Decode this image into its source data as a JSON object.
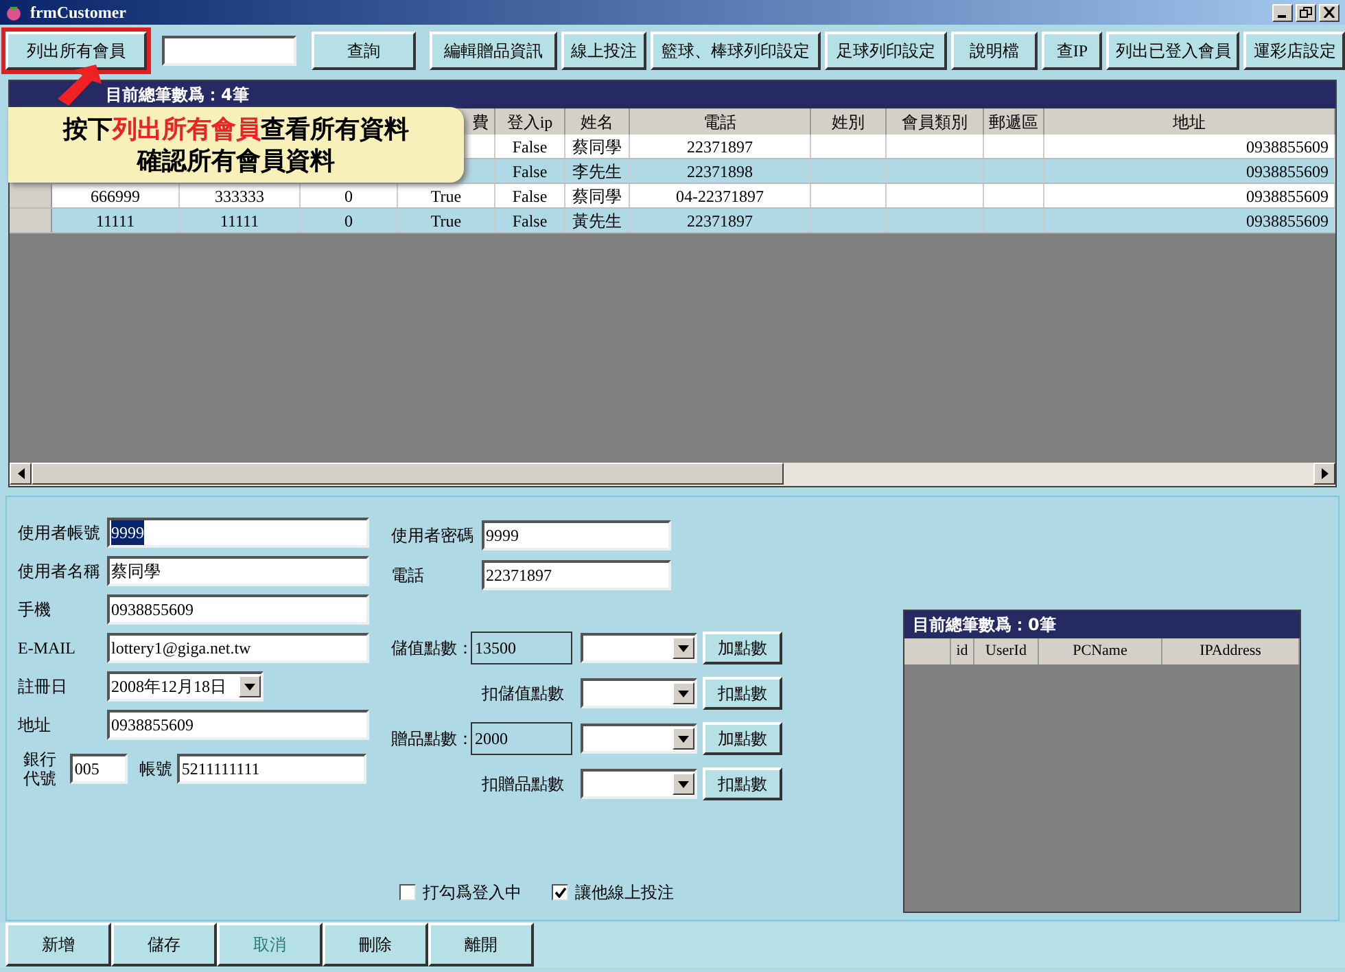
{
  "window": {
    "title": "frmCustomer"
  },
  "toolbar": [
    {
      "kind": "button",
      "label": "列出所有會員",
      "highlighted": true
    },
    {
      "kind": "field"
    },
    {
      "kind": "button",
      "label": "查詢",
      "highlighted": false
    },
    {
      "kind": "button",
      "label": "編輯贈品資訊",
      "highlighted": false
    },
    {
      "kind": "button",
      "label": "線上投注",
      "highlighted": false
    },
    {
      "kind": "button",
      "label": "籃球、棒球列印設定",
      "highlighted": false
    },
    {
      "kind": "button",
      "label": "足球列印設定",
      "highlighted": false
    },
    {
      "kind": "button",
      "label": "說明檔",
      "highlighted": false
    },
    {
      "kind": "button",
      "label": "查IP",
      "highlighted": false
    },
    {
      "kind": "button",
      "label": "列出已登入會員",
      "highlighted": false
    },
    {
      "kind": "button",
      "label": "運彩店設定",
      "highlighted": false
    }
  ],
  "callout": {
    "lines": [
      [
        {
          "text": "按下",
          "emphasis": false
        },
        {
          "text": "列出所有會員",
          "emphasis": true
        },
        {
          "text": "查看所有資料",
          "emphasis": false
        }
      ],
      [
        {
          "text": "確認所有會員資料",
          "emphasis": false
        }
      ]
    ]
  },
  "grid": {
    "title": "目前總筆數爲：4筆",
    "columns": [
      null,
      null,
      null,
      "費",
      "登入ip",
      "姓名",
      "電話",
      "姓別",
      "會員類別",
      "郵遞區",
      "地址"
    ],
    "rows": [
      {
        "cells": [
          null,
          null,
          null,
          null,
          "False",
          "蔡同學",
          "22371897",
          null,
          null,
          null,
          "0938855609"
        ]
      },
      {
        "cells": [
          null,
          null,
          null,
          null,
          "False",
          "李先生",
          "22371898",
          null,
          null,
          null,
          "0938855609"
        ]
      },
      {
        "cells": [
          "666999",
          "333333",
          "0",
          "True",
          "False",
          "蔡同學",
          "04-22371897",
          null,
          null,
          null,
          "0938855609"
        ]
      },
      {
        "cells": [
          "11111",
          "11111",
          "0",
          "True",
          "False",
          "黃先生",
          "22371897",
          null,
          null,
          null,
          "0938855609"
        ]
      }
    ]
  },
  "form": {
    "left": [
      {
        "kind": "text",
        "label": "使用者帳號",
        "value": "9999",
        "text_selected": true
      },
      {
        "kind": "text",
        "label": "使用者名稱",
        "value": "蔡同學",
        "text_selected": false
      },
      {
        "kind": "text",
        "label": "手機",
        "value": "0938855609",
        "text_selected": false
      },
      {
        "kind": "text",
        "label": "E-MAIL",
        "value": "lottery1@giga.net.tw",
        "text_selected": false
      },
      {
        "kind": "date",
        "label": "註冊日",
        "value": "2008年12月18日"
      },
      {
        "kind": "text",
        "label": "地址",
        "value": "0938855609",
        "text_selected": false
      },
      {
        "kind": "bank",
        "label": "銀行代號",
        "value": "005",
        "account_label": "帳號",
        "account_value": "5211111111"
      }
    ],
    "right": [
      {
        "kind": "text",
        "label": "使用者密碼",
        "value": "9999"
      },
      {
        "kind": "text",
        "label": "電話",
        "value": "22371897"
      },
      {
        "kind": "points",
        "label": "儲值點數：",
        "value": "13500",
        "button": "加點數"
      },
      {
        "kind": "deduct",
        "label": "扣儲值點數",
        "button": "扣點數"
      },
      {
        "kind": "points",
        "label": "贈品點數：",
        "value": "2000",
        "button": "加點數"
      },
      {
        "kind": "deduct",
        "label": "扣贈品點數",
        "button": "扣點數"
      }
    ],
    "checkboxes": [
      {
        "label": "打勾爲登入中",
        "checked": false
      },
      {
        "label": "讓他線上投注",
        "checked": true
      }
    ]
  },
  "logged_in": {
    "title": "目前總筆數爲：0筆",
    "columns": [
      "id",
      "UserId",
      "PCName",
      "IPAddress"
    ]
  },
  "bottom_buttons": [
    {
      "label": "新增",
      "disabled": false
    },
    {
      "label": "儲存",
      "disabled": false
    },
    {
      "label": "取消",
      "disabled": true
    },
    {
      "label": "刪除",
      "disabled": false
    },
    {
      "label": "離開",
      "disabled": false
    }
  ]
}
